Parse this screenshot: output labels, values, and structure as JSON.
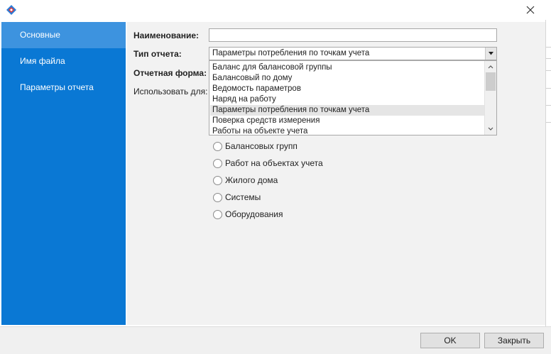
{
  "window": {
    "app_icon": "app-logo-icon",
    "close_icon": "close-icon"
  },
  "sidebar": {
    "items": [
      {
        "label": "Основные",
        "active": true
      },
      {
        "label": "Имя файла",
        "active": false
      },
      {
        "label": "Параметры отчета",
        "active": false
      }
    ]
  },
  "form": {
    "name_label": "Наименование:",
    "name_value": "",
    "type_label": "Тип отчета:",
    "type_value": "Параметры потребления по точкам учета",
    "report_form_label": "Отчетная форма:",
    "use_for_label": "Использовать для:"
  },
  "dropdown": {
    "options": [
      "Баланс для балансовой группы",
      "Балансовый по дому",
      "Ведомость параметров",
      "Наряд на работу",
      "Параметры потребления по точкам учета",
      "Поверка средств измерения",
      "Работы на объекте учета"
    ],
    "selected_index": 4
  },
  "radios": [
    {
      "label": "Балансовых групп",
      "checked": false
    },
    {
      "label": "Работ на объектах учета",
      "checked": false
    },
    {
      "label": "Жилого дома",
      "checked": false
    },
    {
      "label": "Системы",
      "checked": false
    },
    {
      "label": "Оборудования",
      "checked": false
    }
  ],
  "footer": {
    "ok_label": "OK",
    "close_label": "Закрыть"
  },
  "colors": {
    "sidebar": "#0a78d4",
    "sidebar_active": "#3d93df"
  }
}
